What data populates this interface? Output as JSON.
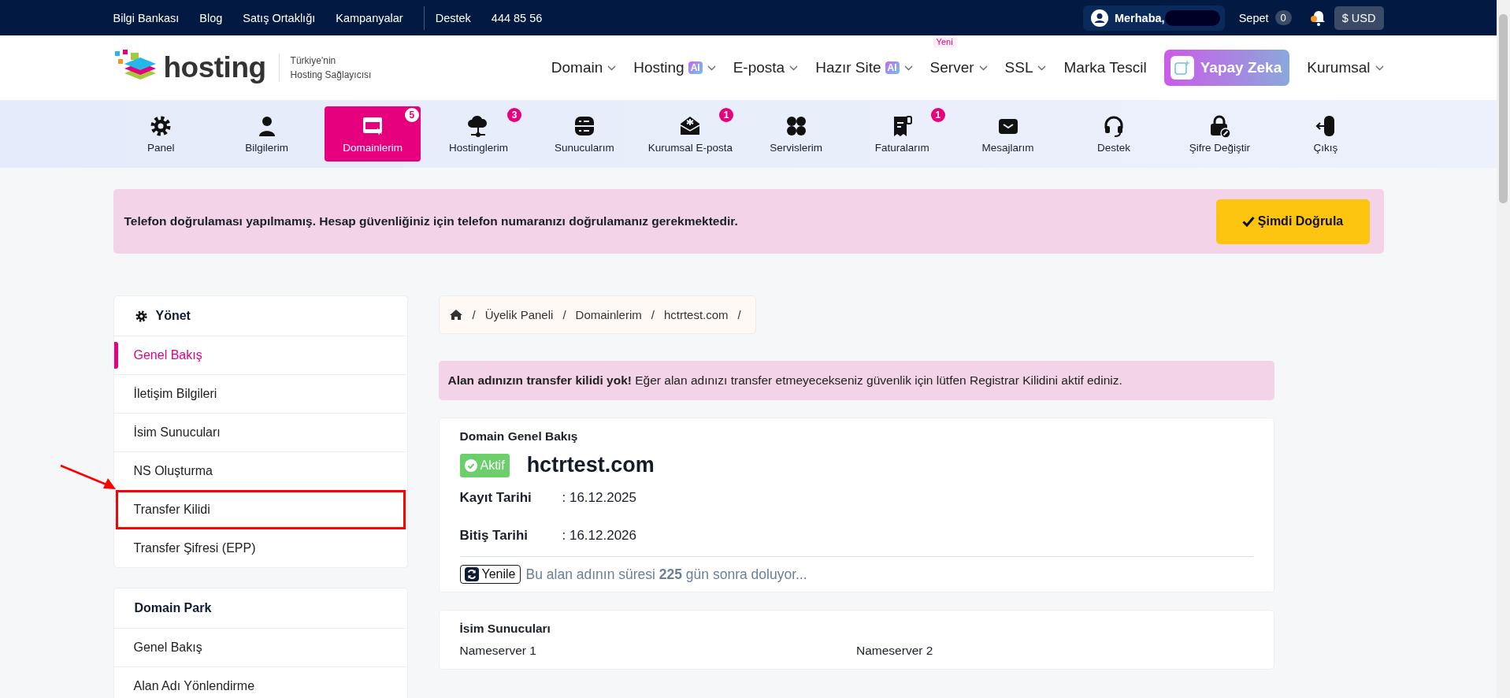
{
  "top_bar": {
    "links": [
      "Bilgi Bankası",
      "Blog",
      "Satış Ortaklığı",
      "Kampanyalar"
    ],
    "support": {
      "label": "Destek",
      "phone": "444 85 56"
    },
    "user": {
      "greeting": "Merhaba,"
    },
    "cart": {
      "label": "Sepet",
      "count": "0"
    },
    "currency": "$ USD"
  },
  "header": {
    "logo": "hosting",
    "tagline": [
      "Türkiye'nin",
      "Hosting Sağlayıcısı"
    ],
    "nav": [
      {
        "label": "Domain",
        "kind": "link",
        "dropdown": true
      },
      {
        "label": "Hosting",
        "kind": "link",
        "ai_badge": "AI",
        "dropdown": true
      },
      {
        "label": "E-posta",
        "kind": "link",
        "dropdown": true
      },
      {
        "label": "Hazır Site",
        "kind": "link",
        "ai_badge": "AI",
        "dropdown": true
      },
      {
        "label": "Server",
        "kind": "link",
        "new_badge": "Yeni",
        "dropdown": true
      },
      {
        "label": "SSL",
        "kind": "link",
        "dropdown": true
      },
      {
        "label": "Marka Tescil",
        "kind": "link",
        "dropdown": false
      },
      {
        "label": "Yapay Zeka",
        "kind": "feature",
        "dropdown": false
      },
      {
        "label": "Kurumsal",
        "kind": "link",
        "dropdown": true
      }
    ]
  },
  "icon_nav": {
    "items": [
      {
        "label": "Panel",
        "selected": false
      },
      {
        "label": "Bilgilerim",
        "selected": false
      },
      {
        "label": "Domainlerim",
        "selected": true,
        "badge": "5"
      },
      {
        "label": "Hostinglerim",
        "selected": false,
        "badge": "3"
      },
      {
        "label": "Sunucularım",
        "selected": false
      },
      {
        "label": "Kurumsal E-posta",
        "selected": false,
        "badge": "1"
      },
      {
        "label": "Servislerim",
        "selected": false
      },
      {
        "label": "Faturalarım",
        "selected": false,
        "badge": "1"
      },
      {
        "label": "Mesajlarım",
        "selected": false
      },
      {
        "label": "Destek",
        "selected": false
      },
      {
        "label": "Şifre Değiştir",
        "selected": false
      },
      {
        "label": "Çıkış",
        "selected": false
      }
    ]
  },
  "verification_alert": {
    "text": "Telefon doğrulaması yapılmamış. Hesap güvenliğiniz için telefon numaranızı doğrulamanız gerekmektedir.",
    "button": "Şimdi Doğrula"
  },
  "sidebar": {
    "sections": [
      {
        "title": "Yönet",
        "items": [
          {
            "label": "Genel Bakış",
            "selected": true
          },
          {
            "label": "İletişim Bilgileri",
            "selected": false
          },
          {
            "label": "İsim Sunucuları",
            "selected": false
          },
          {
            "label": "NS Oluşturma",
            "selected": false
          },
          {
            "label": "Transfer Kilidi",
            "selected": false,
            "highlighted": true
          },
          {
            "label": "Transfer Şifresi (EPP)",
            "selected": false
          }
        ]
      },
      {
        "title": "Domain Park",
        "items": [
          {
            "label": "Genel Bakış",
            "selected": false
          },
          {
            "label": "Alan Adı Yönlendirme",
            "selected": false
          }
        ]
      }
    ]
  },
  "breadcrumb": {
    "separator": "/",
    "items": [
      "Üyelik Paneli",
      "Domainlerim",
      "hctrtest.com"
    ]
  },
  "transfer_notice": "**Alan adınızın transfer kilidi yok!** Eğer alan adınızı transfer etmeyecekseniz güvenlik için lütfen Registrar Kilidini aktif ediniz.",
  "domain_overview": {
    "title": "Domain Genel Bakış",
    "status": "Aktif",
    "domain": "hctrtest.com",
    "dates": [
      {
        "label": "Kayıt Tarihi",
        "value": ": 16.12.2025"
      },
      {
        "label": "Bitiş Tarihi",
        "value": ": 16.12.2026"
      }
    ],
    "renew_button": "Yenile",
    "expiry_text": "Bu alan adının süresi **225** gün sonra doluyor..."
  },
  "name_servers": {
    "title": "İsim Sunucuları",
    "columns": [
      "Nameserver 1",
      "Nameserver 2"
    ]
  }
}
